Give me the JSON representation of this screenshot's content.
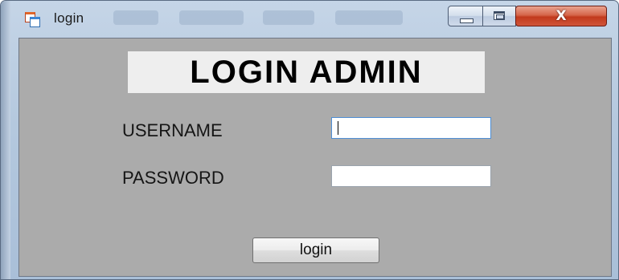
{
  "window": {
    "title": "login",
    "icon": "windows-form-icon",
    "caption_buttons": {
      "minimize_icon": "minimize-icon",
      "maximize_icon": "maximize-icon",
      "close_glyph": "X"
    },
    "accent_close": "#c23a1d"
  },
  "form": {
    "heading": "LOGIN ADMIN",
    "username_label": "USERNAME",
    "username_value": "",
    "password_label": "PASSWORD",
    "password_value": "",
    "login_button_label": "login",
    "background_color": "#ababab"
  }
}
